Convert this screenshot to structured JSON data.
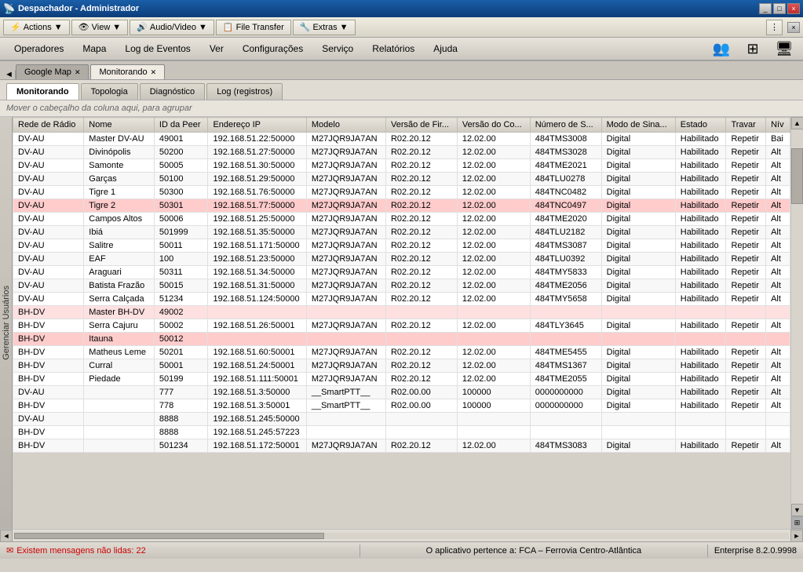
{
  "titlebar": {
    "title": "Despachador - Administrador",
    "controls": [
      "_",
      "□",
      "×"
    ]
  },
  "toolbar": {
    "actions_label": "Actions",
    "view_label": "View",
    "audio_video_label": "Audio/Video",
    "file_transfer_label": "File Transfer",
    "extras_label": "Extras",
    "dropdown_arrow": "▼"
  },
  "menubar": {
    "items": [
      "Operadores",
      "Mapa",
      "Log de Eventos",
      "Ver",
      "Configurações",
      "Serviço",
      "Relatórios",
      "Ajuda"
    ]
  },
  "tabs_outer": [
    {
      "label": "Google Map",
      "closable": true,
      "active": false
    },
    {
      "label": "Monitorando",
      "closable": true,
      "active": true
    }
  ],
  "tabs_inner": [
    {
      "label": "Monitorando",
      "active": true
    },
    {
      "label": "Topologia",
      "active": false
    },
    {
      "label": "Diagnóstico",
      "active": false
    },
    {
      "label": "Log (registros)",
      "active": false
    }
  ],
  "group_header": "Mover o cabeçalho da coluna aqui, para agrupar",
  "table": {
    "columns": [
      "Rede de Rádio",
      "Nome",
      "ID da Peer",
      "Endereço IP",
      "Modelo",
      "Versão de Fir...",
      "Versão do Co...",
      "Número de S...",
      "Modo de Sina...",
      "Estado",
      "Travar",
      "Nív"
    ],
    "rows": [
      {
        "cols": [
          "DV-AU",
          "Master DV-AU",
          "49001",
          "192.168.51.22:50000",
          "M27JQR9JA7AN",
          "R02.20.12",
          "12.02.00",
          "484TMS3008",
          "Digital",
          "Habilitado",
          "Repetir",
          "Bai"
        ],
        "highlight": ""
      },
      {
        "cols": [
          "DV-AU",
          "Divinópolis",
          "50200",
          "192.168.51.27:50000",
          "M27JQR9JA7AN",
          "R02.20.12",
          "12.02.00",
          "484TMS3028",
          "Digital",
          "Habilitado",
          "Repetir",
          "Alt"
        ],
        "highlight": ""
      },
      {
        "cols": [
          "DV-AU",
          "Samonte",
          "50005",
          "192.168.51.30:50000",
          "M27JQR9JA7AN",
          "R02.20.12",
          "12.02.00",
          "484TME2021",
          "Digital",
          "Habilitado",
          "Repetir",
          "Alt"
        ],
        "highlight": ""
      },
      {
        "cols": [
          "DV-AU",
          "Garças",
          "50100",
          "192.168.51.29:50000",
          "M27JQR9JA7AN",
          "R02.20.12",
          "12.02.00",
          "484TLU0278",
          "Digital",
          "Habilitado",
          "Repetir",
          "Alt"
        ],
        "highlight": ""
      },
      {
        "cols": [
          "DV-AU",
          "Tigre 1",
          "50300",
          "192.168.51.76:50000",
          "M27JQR9JA7AN",
          "R02.20.12",
          "12.02.00",
          "484TNC0482",
          "Digital",
          "Habilitado",
          "Repetir",
          "Alt"
        ],
        "highlight": ""
      },
      {
        "cols": [
          "DV-AU",
          "Tigre 2",
          "50301",
          "192.168.51.77:50000",
          "M27JQR9JA7AN",
          "R02.20.12",
          "12.02.00",
          "484TNC0497",
          "Digital",
          "Habilitado",
          "Repetir",
          "Alt"
        ],
        "highlight": "red"
      },
      {
        "cols": [
          "DV-AU",
          "Campos Altos",
          "50006",
          "192.168.51.25:50000",
          "M27JQR9JA7AN",
          "R02.20.12",
          "12.02.00",
          "484TME2020",
          "Digital",
          "Habilitado",
          "Repetir",
          "Alt"
        ],
        "highlight": ""
      },
      {
        "cols": [
          "DV-AU",
          "Ibiá",
          "501999",
          "192.168.51.35:50000",
          "M27JQR9JA7AN",
          "R02.20.12",
          "12.02.00",
          "484TLU2182",
          "Digital",
          "Habilitado",
          "Repetir",
          "Alt"
        ],
        "highlight": ""
      },
      {
        "cols": [
          "DV-AU",
          "Salitre",
          "50011",
          "192.168.51.171:50000",
          "M27JQR9JA7AN",
          "R02.20.12",
          "12.02.00",
          "484TMS3087",
          "Digital",
          "Habilitado",
          "Repetir",
          "Alt"
        ],
        "highlight": ""
      },
      {
        "cols": [
          "DV-AU",
          "EAF",
          "100",
          "192.168.51.23:50000",
          "M27JQR9JA7AN",
          "R02.20.12",
          "12.02.00",
          "484TLU0392",
          "Digital",
          "Habilitado",
          "Repetir",
          "Alt"
        ],
        "highlight": ""
      },
      {
        "cols": [
          "DV-AU",
          "Araguari",
          "50311",
          "192.168.51.34:50000",
          "M27JQR9JA7AN",
          "R02.20.12",
          "12.02.00",
          "484TMY5833",
          "Digital",
          "Habilitado",
          "Repetir",
          "Alt"
        ],
        "highlight": ""
      },
      {
        "cols": [
          "DV-AU",
          "Batista Frazão",
          "50015",
          "192.168.51.31:50000",
          "M27JQR9JA7AN",
          "R02.20.12",
          "12.02.00",
          "484TME2056",
          "Digital",
          "Habilitado",
          "Repetir",
          "Alt"
        ],
        "highlight": ""
      },
      {
        "cols": [
          "DV-AU",
          "Serra Calçada",
          "51234",
          "192.168.51.124:50000",
          "M27JQR9JA7AN",
          "R02.20.12",
          "12.02.00",
          "484TMY5658",
          "Digital",
          "Habilitado",
          "Repetir",
          "Alt"
        ],
        "highlight": ""
      },
      {
        "cols": [
          "BH-DV",
          "Master BH-DV",
          "49002",
          "",
          "",
          "",
          "",
          "",
          "",
          "",
          "",
          ""
        ],
        "highlight": "pink"
      },
      {
        "cols": [
          "BH-DV",
          "Serra Cajuru",
          "50002",
          "192.168.51.26:50001",
          "M27JQR9JA7AN",
          "R02.20.12",
          "12.02.00",
          "484TLY3645",
          "Digital",
          "Habilitado",
          "Repetir",
          "Alt"
        ],
        "highlight": ""
      },
      {
        "cols": [
          "BH-DV",
          "Itauna",
          "50012",
          "",
          "",
          "",
          "",
          "",
          "",
          "",
          "",
          ""
        ],
        "highlight": "red"
      },
      {
        "cols": [
          "BH-DV",
          "Matheus Leme",
          "50201",
          "192.168.51.60:50001",
          "M27JQR9JA7AN",
          "R02.20.12",
          "12.02.00",
          "484TME5455",
          "Digital",
          "Habilitado",
          "Repetir",
          "Alt"
        ],
        "highlight": ""
      },
      {
        "cols": [
          "BH-DV",
          "Curral",
          "50001",
          "192.168.51.24:50001",
          "M27JQR9JA7AN",
          "R02.20.12",
          "12.02.00",
          "484TMS1367",
          "Digital",
          "Habilitado",
          "Repetir",
          "Alt"
        ],
        "highlight": ""
      },
      {
        "cols": [
          "BH-DV",
          "Piedade",
          "50199",
          "192.168.51.111:50001",
          "M27JQR9JA7AN",
          "R02.20.12",
          "12.02.00",
          "484TME2055",
          "Digital",
          "Habilitado",
          "Repetir",
          "Alt"
        ],
        "highlight": ""
      },
      {
        "cols": [
          "DV-AU",
          "",
          "777",
          "192.168.51.3:50000",
          "__SmartPTT__",
          "R02.00.00",
          "100000",
          "0000000000",
          "Digital",
          "Habilitado",
          "Repetir",
          "Alt"
        ],
        "highlight": ""
      },
      {
        "cols": [
          "BH-DV",
          "",
          "778",
          "192.168.51.3:50001",
          "__SmartPTT__",
          "R02.00.00",
          "100000",
          "0000000000",
          "Digital",
          "Habilitado",
          "Repetir",
          "Alt"
        ],
        "highlight": ""
      },
      {
        "cols": [
          "DV-AU",
          "",
          "8888",
          "192.168.51.245:50000",
          "",
          "",
          "",
          "",
          "",
          "",
          "",
          ""
        ],
        "highlight": ""
      },
      {
        "cols": [
          "BH-DV",
          "",
          "8888",
          "192.168.51.245:57223",
          "",
          "",
          "",
          "",
          "",
          "",
          "",
          ""
        ],
        "highlight": ""
      },
      {
        "cols": [
          "BH-DV",
          "",
          "501234",
          "192.168.51.172:50001",
          "M27JQR9JA7AN",
          "R02.20.12",
          "12.02.00",
          "484TMS3083",
          "Digital",
          "Habilitado",
          "Repetir",
          "Alt"
        ],
        "highlight": ""
      }
    ]
  },
  "sidebar": {
    "label": "Gerenciar Usuários"
  },
  "statusbar": {
    "message_icon": "✉",
    "message_text": "Existem mensagens não lidas: 22",
    "center_text": "O aplicativo pertence a:  FCA – Ferrovia Centro-Atlântica",
    "right_text": "Enterprise 8.2.0.9998"
  }
}
